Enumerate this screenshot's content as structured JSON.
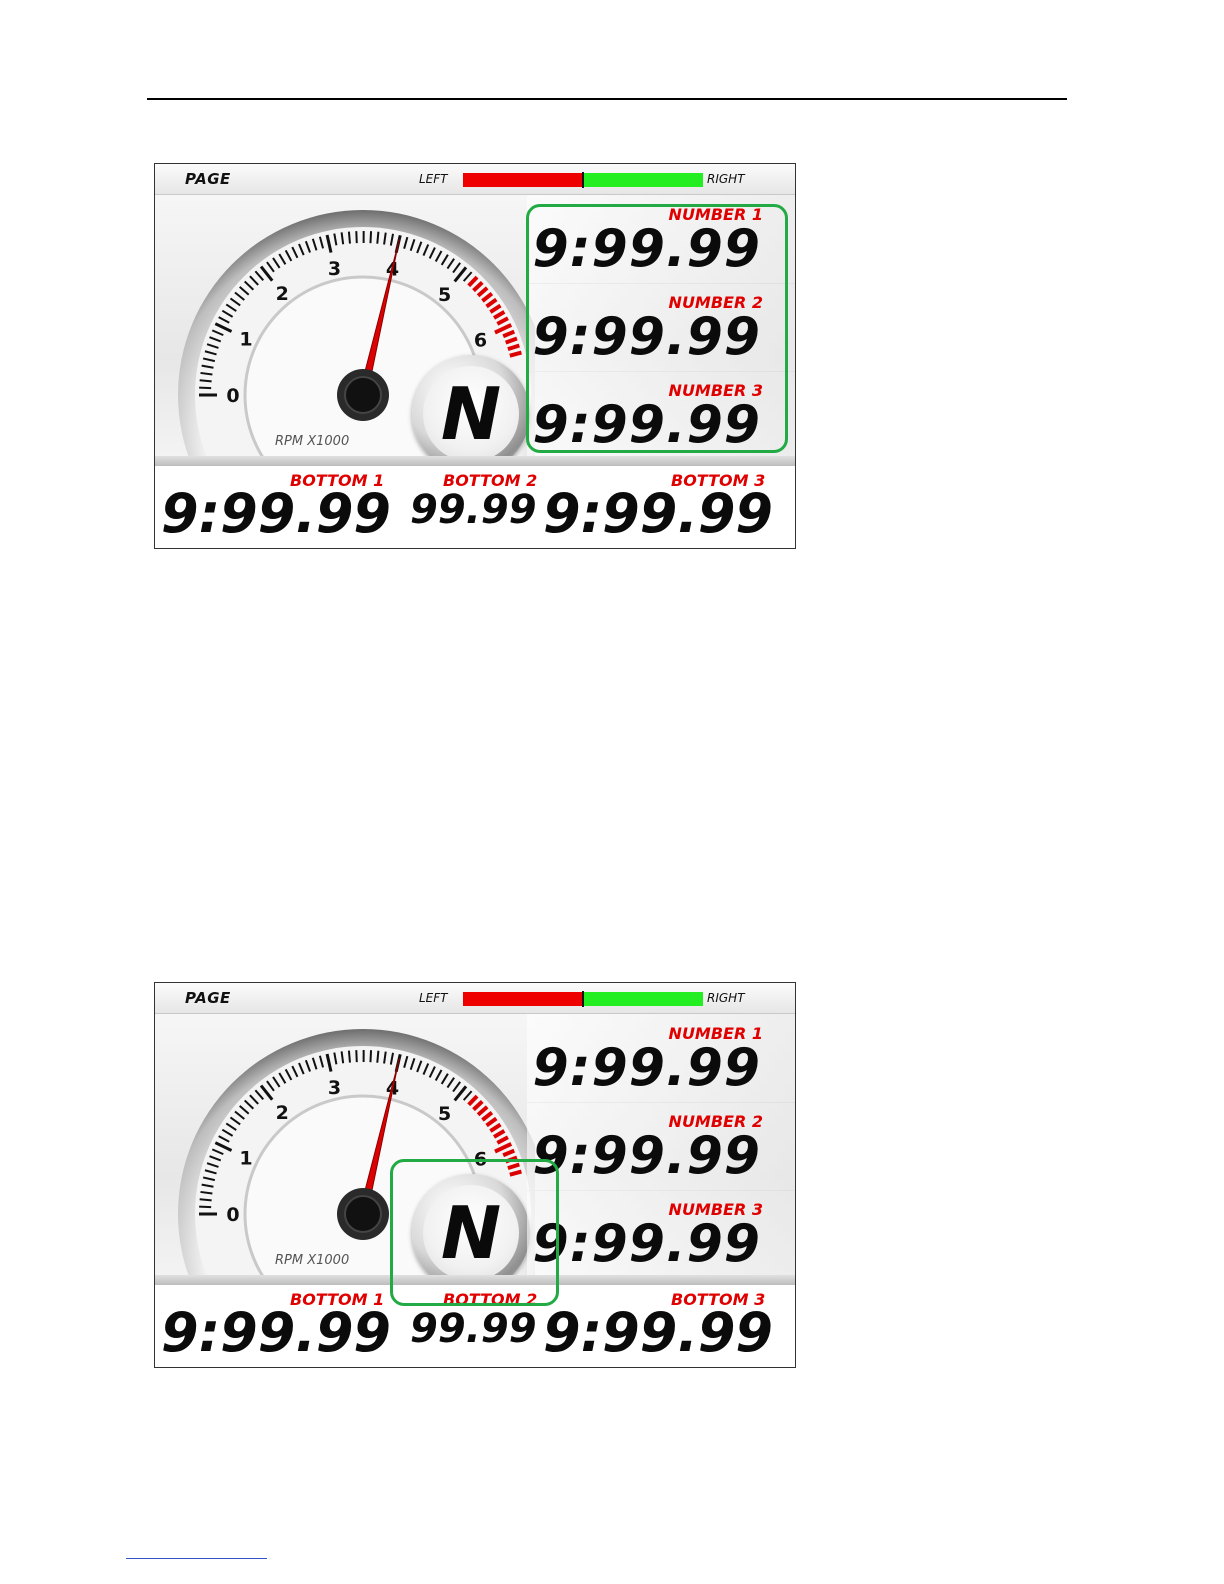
{
  "screens": [
    {
      "topbar": {
        "page_label": "PAGE",
        "left_label": "LEFT",
        "right_label": "RIGHT",
        "balance_left_fraction": 0.5
      },
      "gauge": {
        "unit_label": "RPM X1000",
        "tick_labels": [
          "0",
          "1",
          "2",
          "3",
          "4",
          "5",
          "6"
        ],
        "rpm_value": 4,
        "redline_start": 5.2,
        "max": 6.4
      },
      "gear": "N",
      "numbers": [
        {
          "label": "NUMBER 1",
          "value": "9:99.99"
        },
        {
          "label": "NUMBER 2",
          "value": "9:99.99"
        },
        {
          "label": "NUMBER 3",
          "value": "9:99.99"
        }
      ],
      "bottoms": [
        {
          "label": "BOTTOM 1",
          "value": "9:99.99"
        },
        {
          "label": "BOTTOM 2",
          "value": "99.99"
        },
        {
          "label": "BOTTOM 3",
          "value": "9:99.99"
        }
      ],
      "highlight_color": "#22aa44"
    },
    {
      "topbar": {
        "page_label": "PAGE",
        "left_label": "LEFT",
        "right_label": "RIGHT",
        "balance_left_fraction": 0.5
      },
      "gauge": {
        "unit_label": "RPM X1000",
        "tick_labels": [
          "0",
          "1",
          "2",
          "3",
          "4",
          "5",
          "6"
        ],
        "rpm_value": 4,
        "redline_start": 5.2,
        "max": 6.4
      },
      "gear": "N",
      "numbers": [
        {
          "label": "NUMBER 1",
          "value": "9:99.99"
        },
        {
          "label": "NUMBER 2",
          "value": "9:99.99"
        },
        {
          "label": "NUMBER 3",
          "value": "9:99.99"
        }
      ],
      "bottoms": [
        {
          "label": "BOTTOM 1",
          "value": "9:99.99"
        },
        {
          "label": "BOTTOM 2",
          "value": "99.99"
        },
        {
          "label": "BOTTOM 3",
          "value": "9:99.99"
        }
      ],
      "highlight_color": "#22aa44"
    }
  ]
}
